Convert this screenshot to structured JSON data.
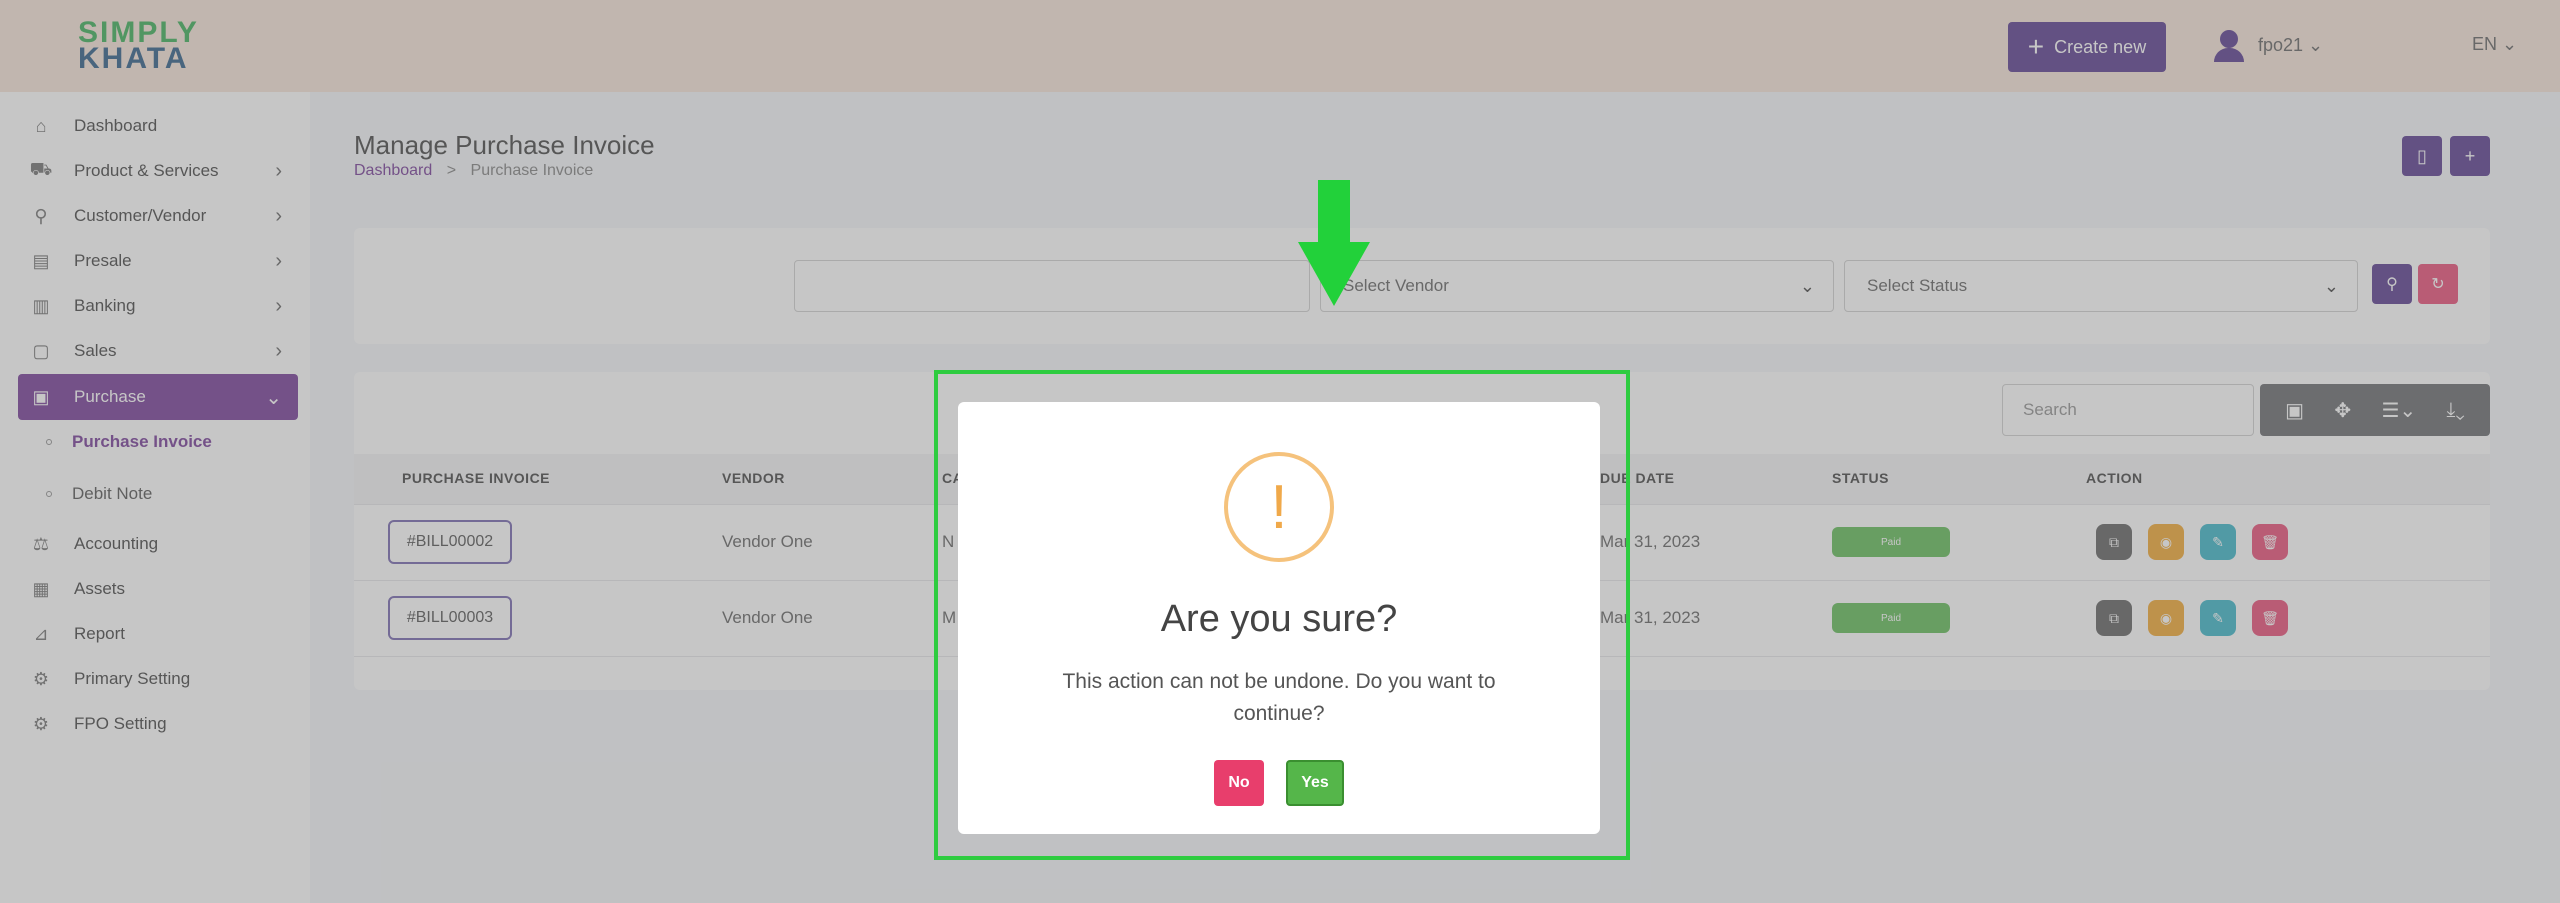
{
  "header": {
    "logo_line1": "SIMPLY",
    "logo_line2": "KHATA",
    "create_new": "Create new",
    "user": "fpo21 ⌄",
    "lang": "EN ⌄"
  },
  "sidebar": {
    "items": [
      {
        "label": "Dashboard",
        "icon": "home-icon",
        "glyph": "⌂"
      },
      {
        "label": "Product & Services",
        "icon": "cart-icon",
        "glyph": "⛟"
      },
      {
        "label": "Customer/Vendor",
        "icon": "user-plus-icon",
        "glyph": "⚲"
      },
      {
        "label": "Presale",
        "icon": "building-icon",
        "glyph": "▤"
      },
      {
        "label": "Banking",
        "icon": "bank-icon",
        "glyph": "▥"
      },
      {
        "label": "Sales",
        "icon": "file-icon",
        "glyph": "▢"
      },
      {
        "label": "Purchase",
        "icon": "clipboard-icon",
        "glyph": "▣"
      },
      {
        "label": "Accounting",
        "icon": "scale-icon",
        "glyph": "⚖"
      },
      {
        "label": "Assets",
        "icon": "calculator-icon",
        "glyph": "▦"
      },
      {
        "label": "Report",
        "icon": "chart-icon",
        "glyph": "⊿"
      },
      {
        "label": "Primary Setting",
        "icon": "gear-icon",
        "glyph": "⚙"
      },
      {
        "label": "FPO Setting",
        "icon": "cog-icon",
        "glyph": "⚙"
      }
    ],
    "sub_items": [
      "Purchase Invoice",
      "Debit Note"
    ]
  },
  "page": {
    "title": "Manage Purchase Invoice",
    "crumb_home": "Dashboard",
    "crumb_sep": ">",
    "crumb_current": "Purchase Invoice"
  },
  "filters": {
    "date_value": "",
    "vendor_placeholder": "Select Vendor",
    "status_placeholder": "Select Status"
  },
  "table": {
    "search_placeholder": "Search",
    "headers": [
      "PURCHASE INVOICE",
      "VENDOR",
      "CA",
      "DUE DATE",
      "STATUS",
      "ACTION"
    ],
    "rows": [
      {
        "invoice": "#BILL00002",
        "vendor": "Vendor One",
        "cat": "N",
        "due": "Mar 31, 2023",
        "status": "Paid"
      },
      {
        "invoice": "#BILL00003",
        "vendor": "Vendor One",
        "cat": "M",
        "due": "Mar 31, 2023",
        "status": "Paid"
      }
    ]
  },
  "modal": {
    "icon": "!",
    "title": "Are you sure?",
    "text": "This action can not be undone. Do you want to continue?",
    "no": "No",
    "yes": "Yes"
  },
  "colors": {
    "accent": "#4b2a86",
    "highlight": "#2ecc40",
    "paid": "#55b64a",
    "danger": "#e83e6c"
  }
}
